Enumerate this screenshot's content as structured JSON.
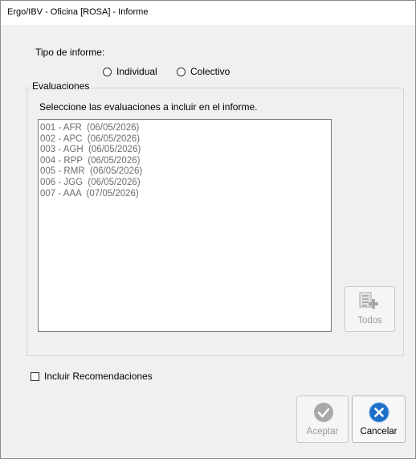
{
  "window": {
    "title": "Ergo/IBV - Oficina [ROSA] - Informe"
  },
  "tipo_informe": {
    "label": "Tipo de informe:",
    "options": [
      {
        "label": "Individual",
        "selected": false
      },
      {
        "label": "Colectivo",
        "selected": false
      }
    ]
  },
  "evaluaciones": {
    "title": "Evaluaciones",
    "instruction": "Seleccione las evaluaciones a incluir en el informe.",
    "items": [
      "001 - AFR  (06/05/2026)",
      "002 - APC  (06/05/2026)",
      "003 - AGH  (06/05/2026)",
      "004 - RPP  (06/05/2026)",
      "005 - RMR  (06/05/2026)",
      "006 - JGG  (06/05/2026)",
      "007 - AAA  (07/05/2026)"
    ],
    "todos_label": "Todos"
  },
  "recomendaciones": {
    "label": "Incluir Recomendaciones",
    "checked": false
  },
  "buttons": {
    "aceptar": "Aceptar",
    "cancelar": "Cancelar"
  },
  "colors": {
    "cancel_icon": "#1e6fc6",
    "disabled_icon": "#a8a8a8"
  }
}
